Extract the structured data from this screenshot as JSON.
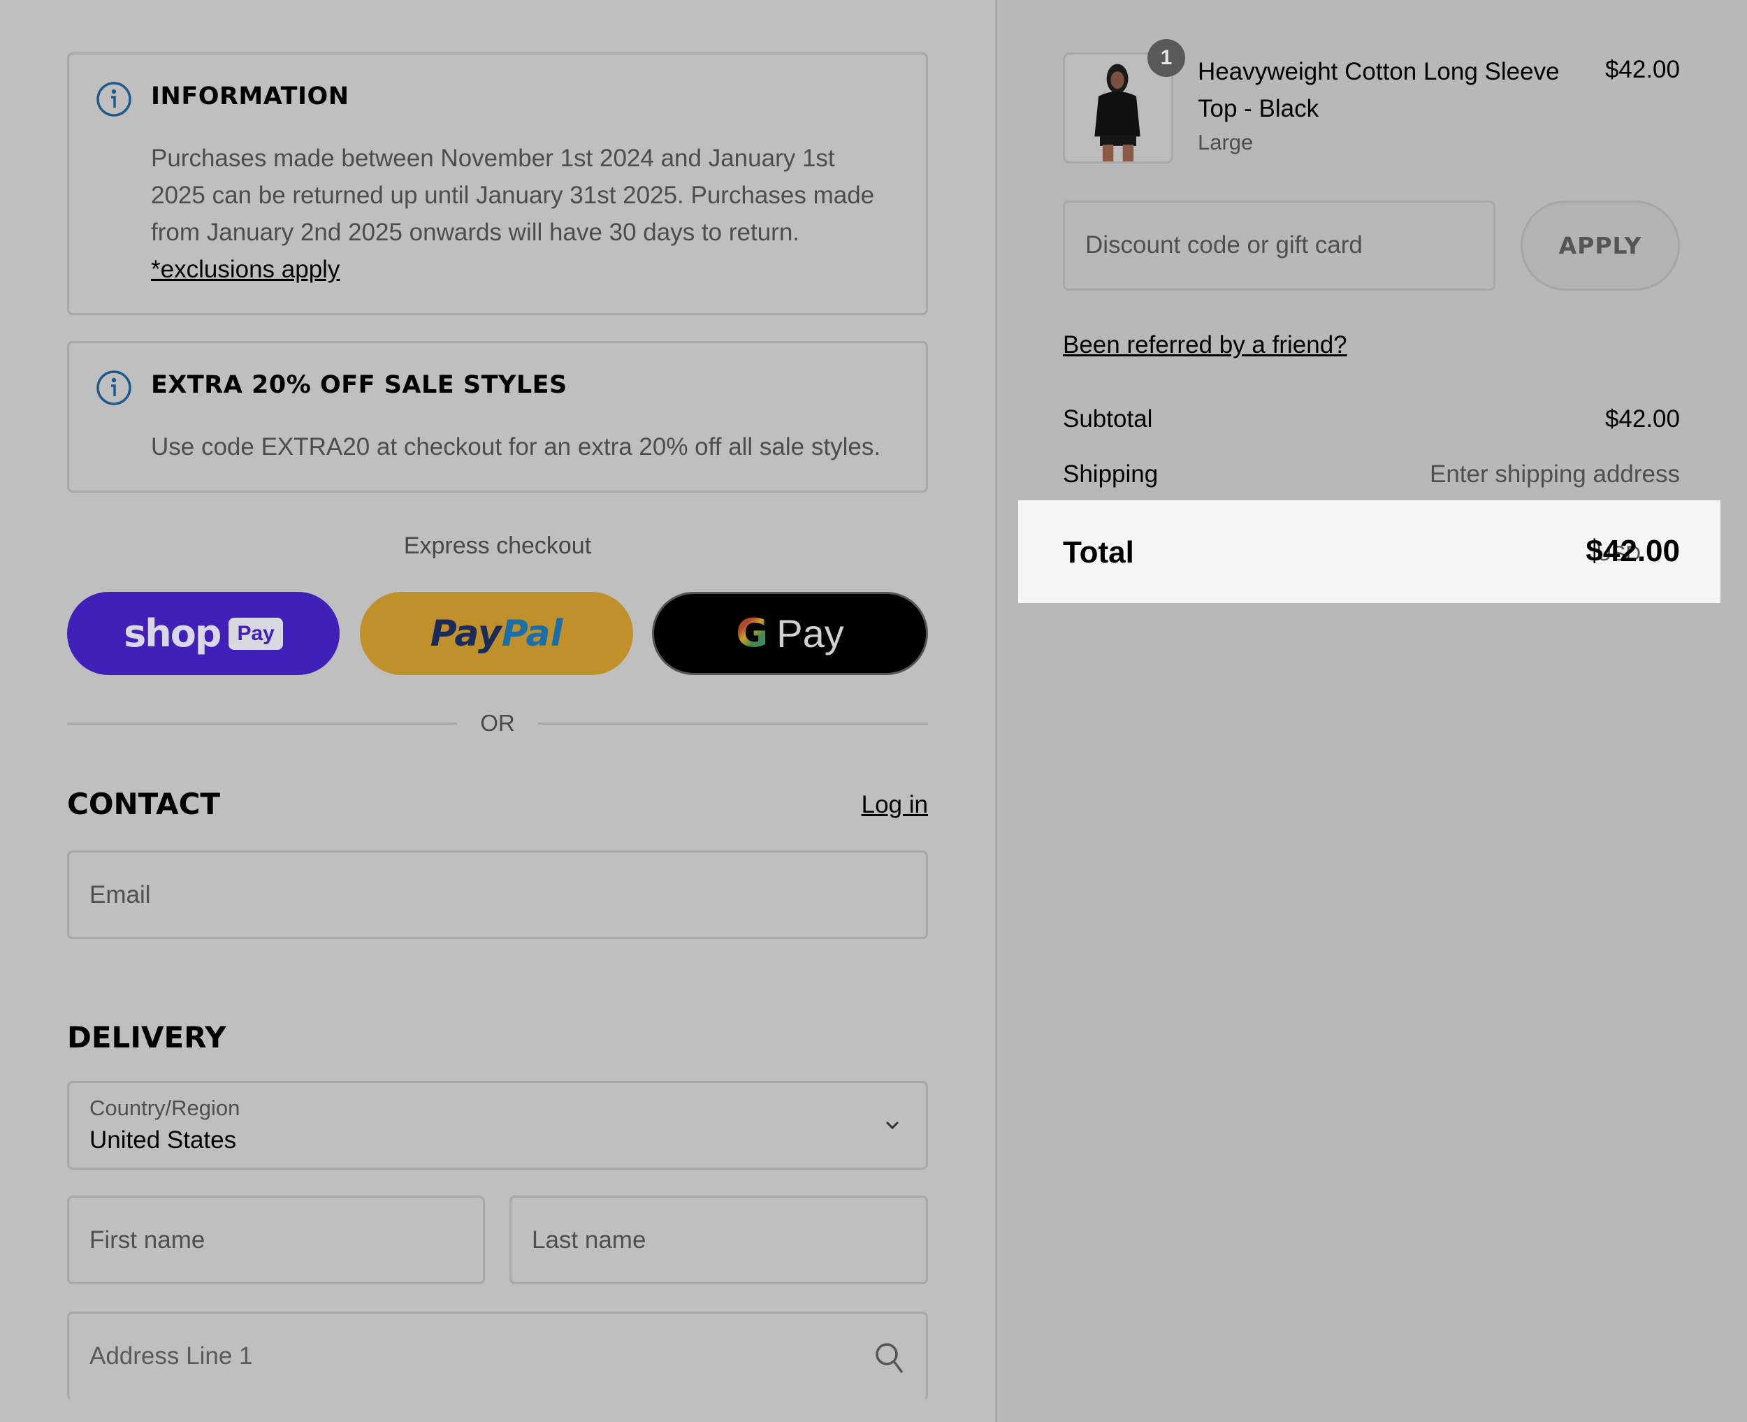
{
  "notices": [
    {
      "icon": "info-icon",
      "title": "INFORMATION",
      "body": "Purchases made between November 1st 2024 and January 1st 2025 can be returned up until January 31st 2025. Purchases made from January 2nd 2025 onwards will have 30 days to return. ",
      "link": "*exclusions apply"
    },
    {
      "icon": "info-icon",
      "title": "EXTRA 20% OFF SALE STYLES",
      "body": "Use code EXTRA20 at checkout for an extra 20% off all sale styles."
    }
  ],
  "express_checkout": {
    "label": "Express checkout",
    "buttons": {
      "shop_pay": {
        "word": "shop",
        "badge": "Pay",
        "color": "#4120b9"
      },
      "paypal": {
        "pay": "Pay",
        "pal": "Pal",
        "color": "#c0912b"
      },
      "google_pay": {
        "g": "G",
        "pay": "Pay",
        "color": "#000000"
      }
    },
    "separator": "OR"
  },
  "contact": {
    "title": "CONTACT",
    "login_link": "Log in",
    "email_placeholder": "Email"
  },
  "delivery": {
    "title": "DELIVERY",
    "country_label": "Country/Region",
    "country_value": "United States",
    "first_name_placeholder": "First name",
    "last_name_placeholder": "Last name",
    "address_placeholder": "Address Line 1"
  },
  "order_summary": {
    "item": {
      "quantity": "1",
      "title": "Heavyweight Cotton Long Sleeve Top - Black",
      "variant": "Large",
      "price": "$42.00"
    },
    "discount_placeholder": "Discount code or gift card",
    "apply_label": "APPLY",
    "referral_link": "Been referred by a friend?",
    "subtotal_label": "Subtotal",
    "subtotal_value": "$42.00",
    "shipping_label": "Shipping",
    "shipping_value": "Enter shipping address",
    "total_label": "Total",
    "total_currency": "USD",
    "total_value": "$42.00"
  },
  "colors": {
    "info_icon": "#1f5a8a",
    "total_band": "#f5f5f5"
  }
}
